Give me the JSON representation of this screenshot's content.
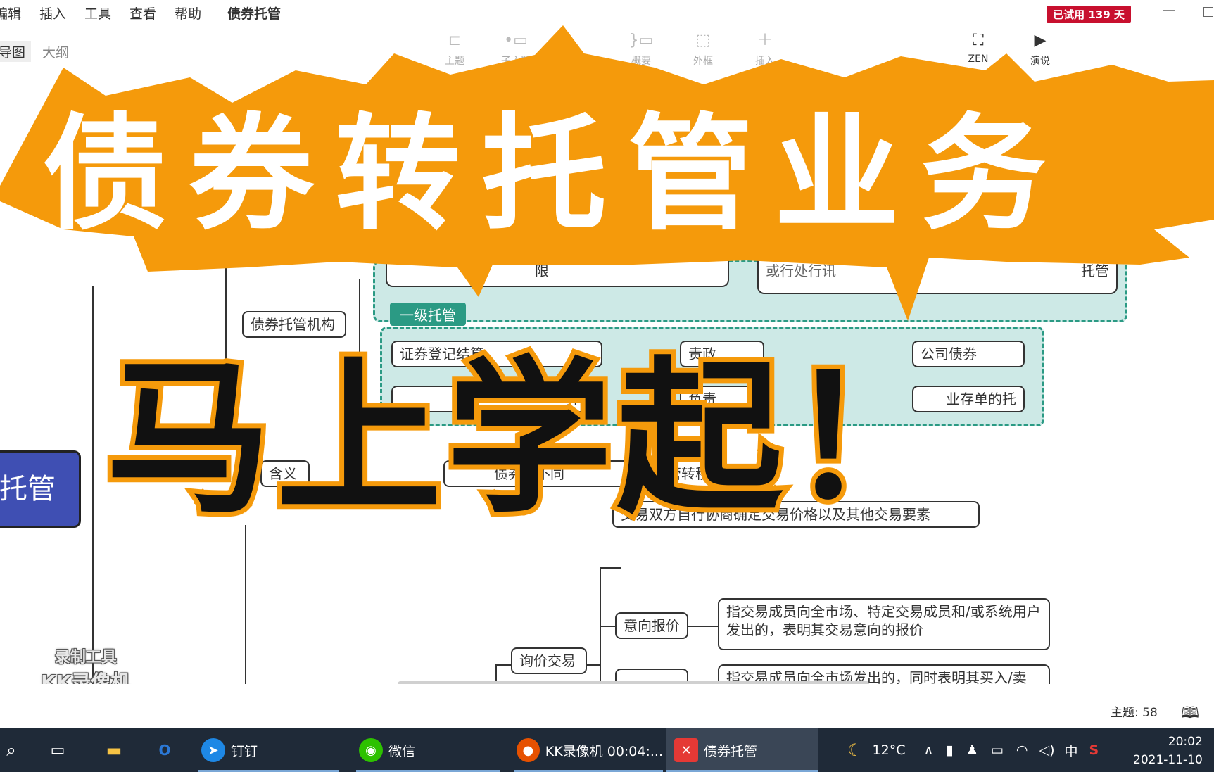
{
  "menubar": {
    "items": [
      "编辑",
      "插入",
      "工具",
      "查看",
      "帮助"
    ],
    "doc_title": "债券托管",
    "trial_badge": "已试用 139 天"
  },
  "toolbar": {
    "view_tab_active": "导图",
    "view_tab_outline": "大纲",
    "tools": [
      {
        "label": "主题",
        "icon": "topic-icon"
      },
      {
        "label": "子主题",
        "icon": "subtopic-icon"
      },
      {
        "label": "概要",
        "icon": "summary-icon"
      },
      {
        "label": "外框",
        "icon": "boundary-icon"
      },
      {
        "label": "插入",
        "icon": "plus-icon"
      },
      {
        "label": "ZEN",
        "icon": "fullscreen-icon"
      },
      {
        "label": "演说",
        "icon": "play-icon"
      }
    ]
  },
  "overlay": {
    "title_line1": "债券转托管业务",
    "title_line2": "马上学起！",
    "accent_color": "#f59a0b"
  },
  "mindmap": {
    "root": "托管",
    "nodes": {
      "custody_org": "债券托管机构",
      "level1_tag": "一级托管",
      "meaning": "含义",
      "frag_a": "证券登记结算",
      "frag_b": "责政",
      "frag_c": "公司债券",
      "frag_d": "算服",
      "frag_e": "负责",
      "frag_f": "业存单的托",
      "frag_g": "债券在不同",
      "frag_h": "托管转移",
      "frag_top1": "限",
      "frag_top2": "或行处行讯",
      "frag_top3": "托管",
      "trade_elements": "交易双方自行协商确定交易价格以及其他交易要素",
      "intent_quote": "意向报价",
      "intent_desc": "指交易成员向全市场、特定交易成员和/或系统用户发出的，表明其交易意向的报价",
      "inquiry_trade": "询价交易",
      "cut_desc": "指交易成员向全市场发出的，同时表明其买入/卖"
    },
    "watermark_line1": "录制工具",
    "watermark_line2": "KK录像机"
  },
  "statusbar": {
    "topic_count": "主题: 58"
  },
  "taskbar": {
    "apps": [
      {
        "label": "钉钉",
        "icon": "dingtalk-icon",
        "color": "#1e88e5"
      },
      {
        "label": "微信",
        "icon": "wechat-icon",
        "color": "#2dc100"
      },
      {
        "label": "KK录像机 00:04:...",
        "icon": "kk-recorder-icon",
        "color": "#e65100"
      },
      {
        "label": "债券托管",
        "icon": "xmind-icon",
        "color": "#e53935"
      }
    ],
    "weather": "12°C",
    "ime": "中",
    "time": "20:02",
    "date": "2021-11-10"
  }
}
